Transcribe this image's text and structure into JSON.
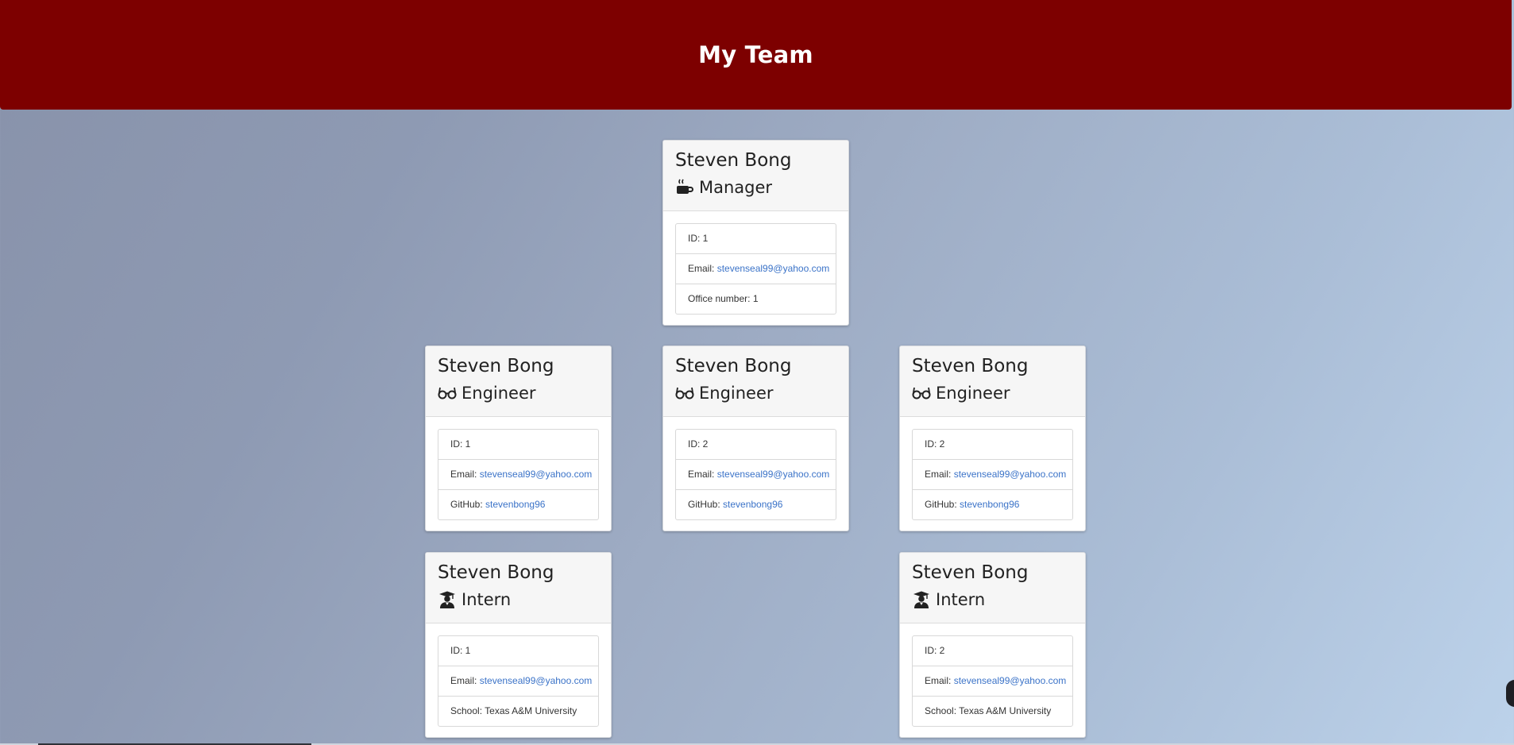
{
  "header": {
    "title": "My Team"
  },
  "cards": [
    {
      "name": "Steven Bong",
      "role": "Manager",
      "icon": "coffee-icon",
      "details": [
        {
          "label": "ID: ",
          "value": "1"
        },
        {
          "label": "Email: ",
          "value": "stevenseal99@yahoo.com"
        },
        {
          "label": "Office number: ",
          "value": "1"
        }
      ]
    },
    {
      "name": "Steven Bong",
      "role": "Engineer",
      "icon": "glasses-icon",
      "details": [
        {
          "label": "ID: ",
          "value": "1"
        },
        {
          "label": "Email: ",
          "value": "stevenseal99@yahoo.com"
        },
        {
          "label": "GitHub: ",
          "value": "stevenbong96"
        }
      ]
    },
    {
      "name": "Steven Bong",
      "role": "Engineer",
      "icon": "glasses-icon",
      "details": [
        {
          "label": "ID: ",
          "value": "2"
        },
        {
          "label": "Email: ",
          "value": "stevenseal99@yahoo.com"
        },
        {
          "label": "GitHub: ",
          "value": "stevenbong96"
        }
      ]
    },
    {
      "name": "Steven Bong",
      "role": "Engineer",
      "icon": "glasses-icon",
      "details": [
        {
          "label": "ID: ",
          "value": "2"
        },
        {
          "label": "Email: ",
          "value": "stevenseal99@yahoo.com"
        },
        {
          "label": "GitHub: ",
          "value": "stevenbong96"
        }
      ]
    },
    {
      "name": "Steven Bong",
      "role": "Intern",
      "icon": "graduate-icon",
      "details": [
        {
          "label": "ID: ",
          "value": "1"
        },
        {
          "label": "Email: ",
          "value": "stevenseal99@yahoo.com"
        },
        {
          "label": "School: ",
          "value": "Texas A&M University"
        }
      ]
    },
    {
      "name": "Steven Bong",
      "role": "Intern",
      "icon": "graduate-icon",
      "details": [
        {
          "label": "ID: ",
          "value": "2"
        },
        {
          "label": "Email: ",
          "value": "stevenseal99@yahoo.com"
        },
        {
          "label": "School: ",
          "value": "Texas A&M University"
        }
      ]
    }
  ],
  "colors": {
    "header_bg": "#7d0000",
    "link": "#3b73c8"
  }
}
